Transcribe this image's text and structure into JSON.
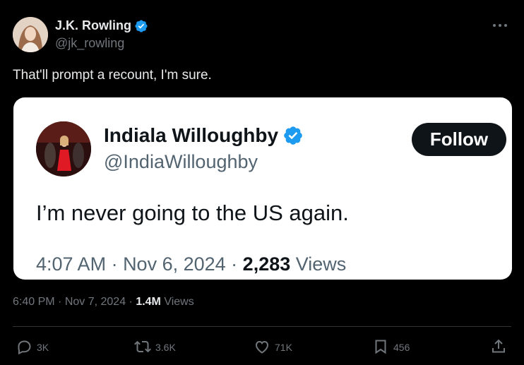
{
  "author": {
    "name": "J.K. Rowling",
    "handle": "@jk_rowling"
  },
  "tweet": {
    "text": "That'll prompt a recount, I'm sure.",
    "time": "6:40 PM",
    "date": "Nov 7, 2024",
    "views_count": "1.4M",
    "views_label": "Views"
  },
  "quoted": {
    "name": "Indiala Willoughby",
    "handle": "@IndiaWilloughby",
    "follow_label": "Follow",
    "text": "I’m never going to the US again.",
    "time": "4:07 AM",
    "date": "Nov 6, 2024",
    "views_count": "2,283",
    "views_label": "Views"
  },
  "actions": {
    "replies": "3K",
    "reposts": "3.6K",
    "likes": "71K",
    "bookmarks": "456"
  },
  "colors": {
    "background": "#000000",
    "verified": "#1d9bf0",
    "card_background": "#ffffff",
    "muted": "#71767b"
  },
  "icons": {
    "verified": "verified-badge-icon",
    "more": "more-icon",
    "reply": "reply-icon",
    "repost": "repost-icon",
    "like": "heart-icon",
    "bookmark": "bookmark-icon",
    "share": "share-icon"
  }
}
